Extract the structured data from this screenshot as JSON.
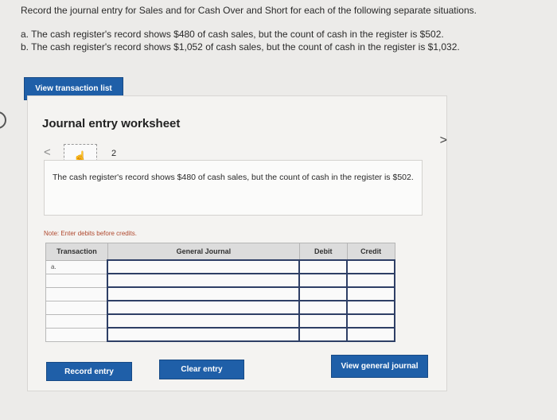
{
  "question": {
    "prompt": "Record the journal entry for Sales and for Cash Over and Short for each of the following separate situations.",
    "items": [
      "a. The cash register's record shows $480 of cash sales, but the count of cash in the register is $502.",
      "b. The cash register's record shows $1,052 of cash sales, but the count of cash in the register is $1,032."
    ]
  },
  "buttons": {
    "view_transaction_list": "View transaction list",
    "record_entry": "Record entry",
    "clear_entry": "Clear entry",
    "view_general_journal": "View general journal"
  },
  "worksheet": {
    "title": "Journal entry worksheet",
    "nav_prev": "<",
    "nav_next": ">",
    "step_icon": "hand-pointer-icon",
    "step_number": "2",
    "scenario_text": "The cash register's record shows $480 of cash sales, but the count of cash in the register is $502.",
    "note": "Note: Enter debits before credits."
  },
  "journal_table": {
    "headers": [
      "Transaction",
      "General Journal",
      "Debit",
      "Credit"
    ],
    "rows": [
      {
        "transaction": "a.",
        "account": "",
        "debit": "",
        "credit": ""
      },
      {
        "transaction": "",
        "account": "",
        "debit": "",
        "credit": ""
      },
      {
        "transaction": "",
        "account": "",
        "debit": "",
        "credit": ""
      },
      {
        "transaction": "",
        "account": "",
        "debit": "",
        "credit": ""
      },
      {
        "transaction": "",
        "account": "",
        "debit": "",
        "credit": ""
      },
      {
        "transaction": "",
        "account": "",
        "debit": "",
        "credit": ""
      }
    ]
  },
  "colors": {
    "button_blue": "#1f5fa8",
    "input_border": "#2e3f66",
    "note_text": "#b0492f"
  }
}
